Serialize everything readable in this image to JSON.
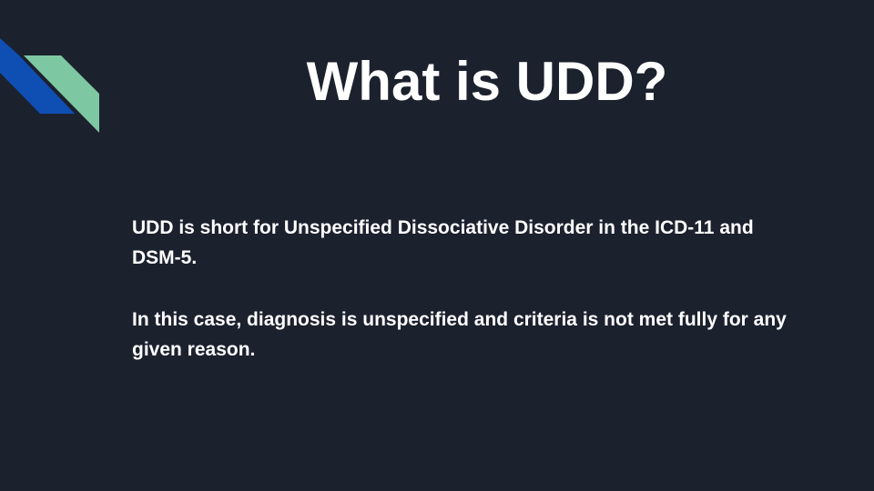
{
  "slide": {
    "title": "What is UDD?",
    "paragraphs": [
      "UDD is short for Unspecified Dissociative Disorder in the ICD-11 and DSM-5.",
      "In this case, diagnosis is unspecified and criteria is not met fully for any given reason."
    ]
  },
  "colors": {
    "background": "#1c212e",
    "accent_blue": "#0f4fb4",
    "accent_green": "#7ec7a3",
    "text": "#ffffff"
  }
}
